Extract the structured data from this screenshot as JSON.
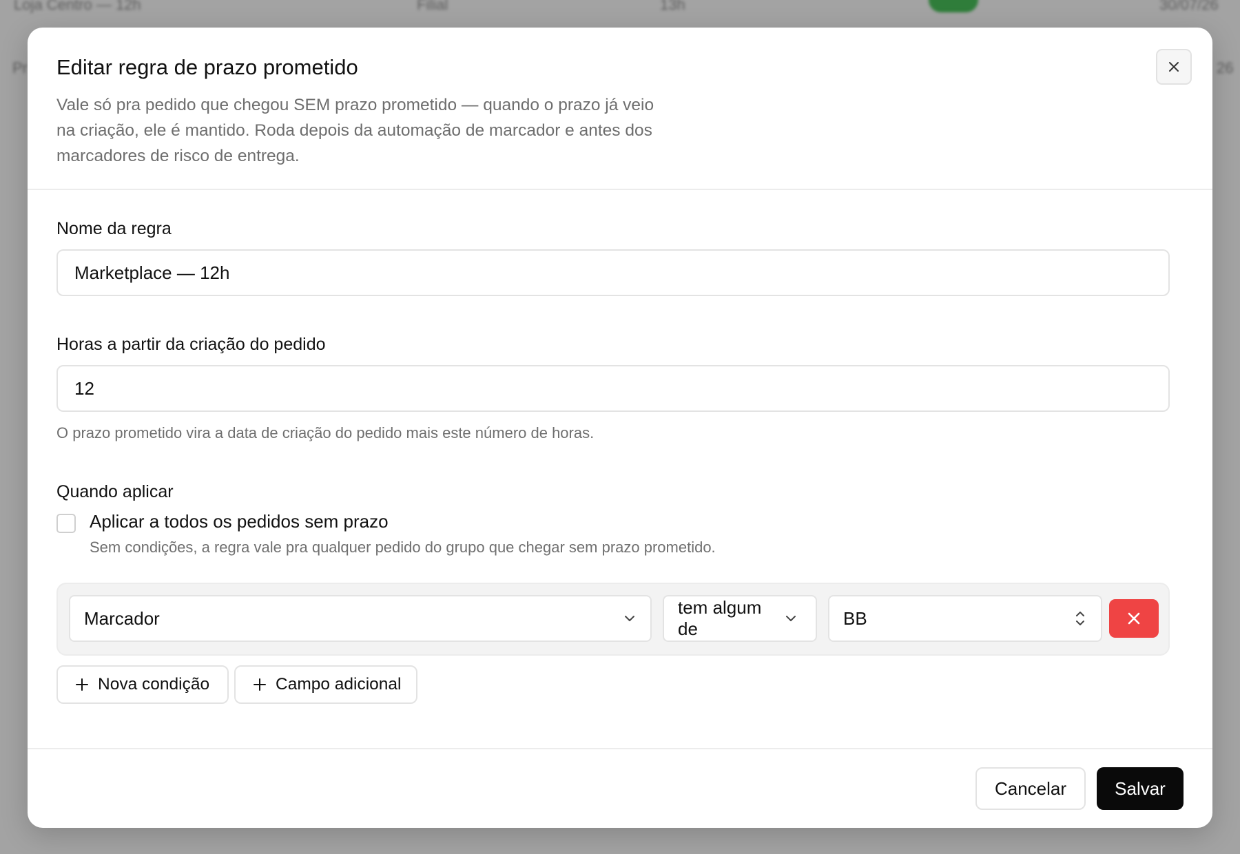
{
  "background": {
    "row1": [
      "Loja Centro — 12h",
      "Filial",
      "13h",
      "30/07/26"
    ],
    "row2_prefix": "Pr",
    "row2_suffix": "26",
    "toggle_color": "#2f7d3a"
  },
  "modal": {
    "title": "Editar regra de prazo prometido",
    "description": "Vale só pra pedido que chegou SEM prazo prometido — quando o prazo já veio na criação, ele é mantido. Roda depois da automação de marcador e antes dos marcadores de risco de entrega."
  },
  "form": {
    "name_label": "Nome da regra",
    "name_value": "Marketplace — 12h",
    "hours_label": "Horas a partir da criação do pedido",
    "hours_value": "12",
    "hours_hint": "O prazo prometido vira a data de criação do pedido mais este número de horas.",
    "when_label": "Quando aplicar",
    "apply_all_label": "Aplicar a todos os pedidos sem prazo",
    "apply_all_checked": false,
    "apply_all_hint": "Sem condições, a regra vale pra qualquer pedido do grupo que chegar sem prazo prometido."
  },
  "condition": {
    "field": "Marcador",
    "operator": "tem algum de",
    "value": "BB"
  },
  "actions": {
    "new_condition": "Nova condição",
    "extra_field": "Campo adicional",
    "cancel": "Cancelar",
    "save": "Salvar"
  },
  "colors": {
    "danger": "#ef4444",
    "primary": "#0a0a0a"
  }
}
